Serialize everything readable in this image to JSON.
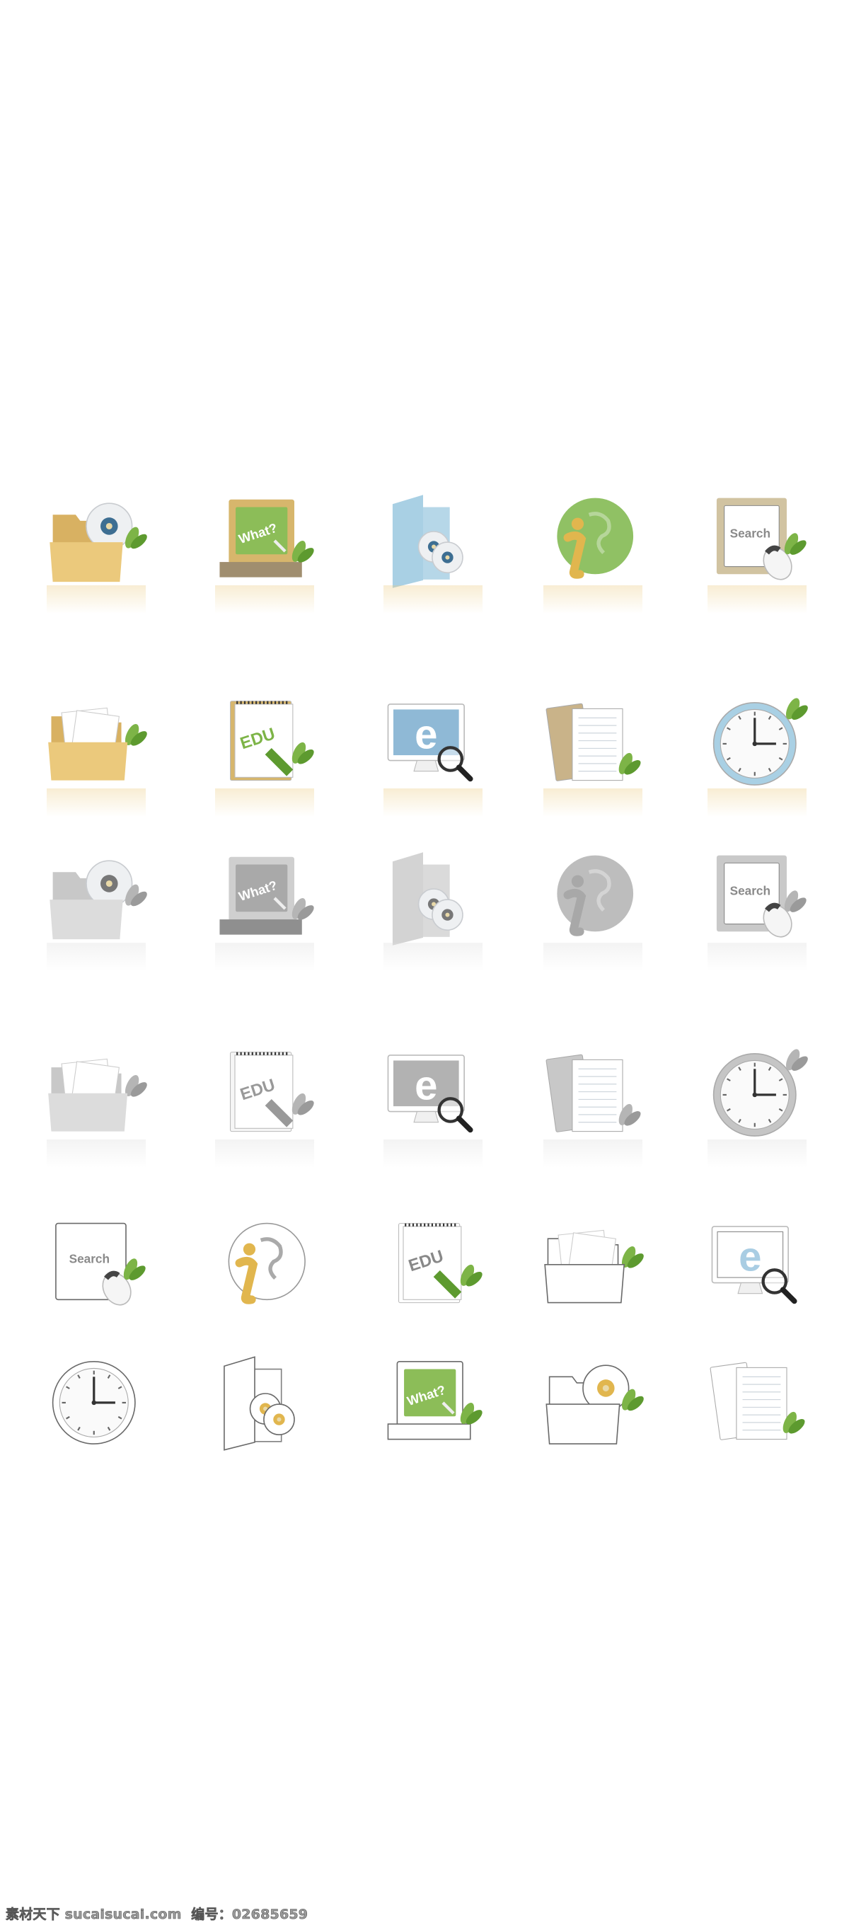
{
  "labels": {
    "what": "What?",
    "search": "Search",
    "edu": "EDU",
    "ie": "e",
    "info": "i"
  },
  "colors": {
    "folder": "#ebc97c",
    "folder_dark": "#d8b162",
    "leaf": "#7db447",
    "leaf_dark": "#5d9a2f",
    "chalkboard": "#8cbd58",
    "frame": "#d7b66c",
    "base": "#a08e6f",
    "blue": "#a9d0e4",
    "globe": "#90c164",
    "info": "#e1b64e",
    "search_frame": "#d1c3a1",
    "screen_blue": "#8fb9d6"
  },
  "rows": [
    {
      "style": "color",
      "icons": [
        "folder-cd",
        "chalkboard-what",
        "cd-case",
        "globe-info",
        "search-mouse"
      ]
    },
    {
      "style": "color",
      "icons": [
        "folder-documents",
        "notepad-edu",
        "monitor-ie-search",
        "book-notes",
        "clock"
      ]
    },
    {
      "style": "gray",
      "icons": [
        "folder-cd",
        "chalkboard-what",
        "cd-case",
        "globe-info",
        "search-mouse"
      ]
    },
    {
      "style": "gray",
      "icons": [
        "folder-documents",
        "notepad-edu",
        "monitor-ie-search",
        "book-notes",
        "clock"
      ]
    },
    {
      "style": "outline",
      "icons": [
        "search-mouse",
        "globe-info",
        "notepad-edu",
        "folder-documents",
        "monitor-ie-search"
      ]
    },
    {
      "style": "outline",
      "icons": [
        "clock",
        "cd-case",
        "chalkboard-what",
        "folder-cd",
        "book-notes"
      ]
    }
  ],
  "watermark": "素材天下 sucaisucai.com  编号：02685659"
}
